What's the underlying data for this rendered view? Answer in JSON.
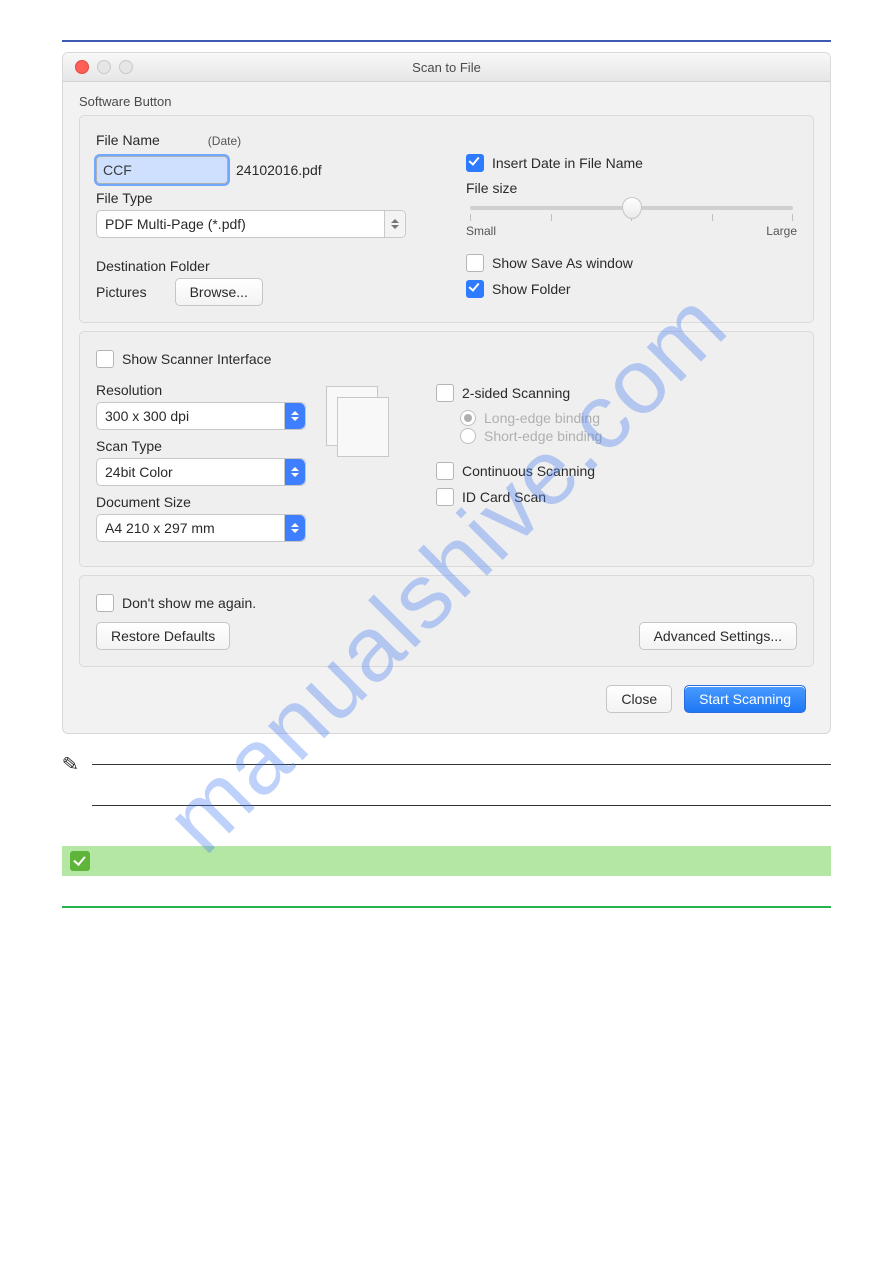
{
  "header_rule_color": "#3d59b0",
  "watermark": "manualshive.com",
  "dialog": {
    "title": "Scan to File",
    "section_label": "Software Button",
    "file_name_label": "File Name",
    "date_label": "(Date)",
    "file_name_value": "CCF",
    "date_suffix": "24102016.pdf",
    "file_type_label": "File Type",
    "file_type_value": "PDF Multi-Page (*.pdf)",
    "destination_folder_label": "Destination Folder",
    "destination_folder_value": "Pictures",
    "browse_button": "Browse...",
    "insert_date_label": "Insert Date in File Name",
    "insert_date_checked": true,
    "file_size_label": "File size",
    "file_size_small": "Small",
    "file_size_large": "Large",
    "show_save_as_label": "Show Save As window",
    "show_save_as_checked": false,
    "show_folder_label": "Show Folder",
    "show_folder_checked": true,
    "show_scanner_interface_label": "Show Scanner Interface",
    "show_scanner_interface_checked": false,
    "resolution_label": "Resolution",
    "resolution_value": "300 x 300 dpi",
    "scan_type_label": "Scan Type",
    "scan_type_value": "24bit Color",
    "document_size_label": "Document Size",
    "document_size_value": "A4 210 x 297 mm",
    "two_sided_label": "2-sided Scanning",
    "two_sided_checked": false,
    "long_edge_label": "Long-edge binding",
    "short_edge_label": "Short-edge binding",
    "continuous_label": "Continuous Scanning",
    "continuous_checked": false,
    "id_card_label": "ID Card Scan",
    "id_card_checked": false,
    "dont_show_label": "Don't show me again.",
    "dont_show_checked": false,
    "restore_defaults": "Restore Defaults",
    "advanced_settings": "Advanced Settings...",
    "close_button": "Close",
    "start_button": "Start Scanning"
  }
}
